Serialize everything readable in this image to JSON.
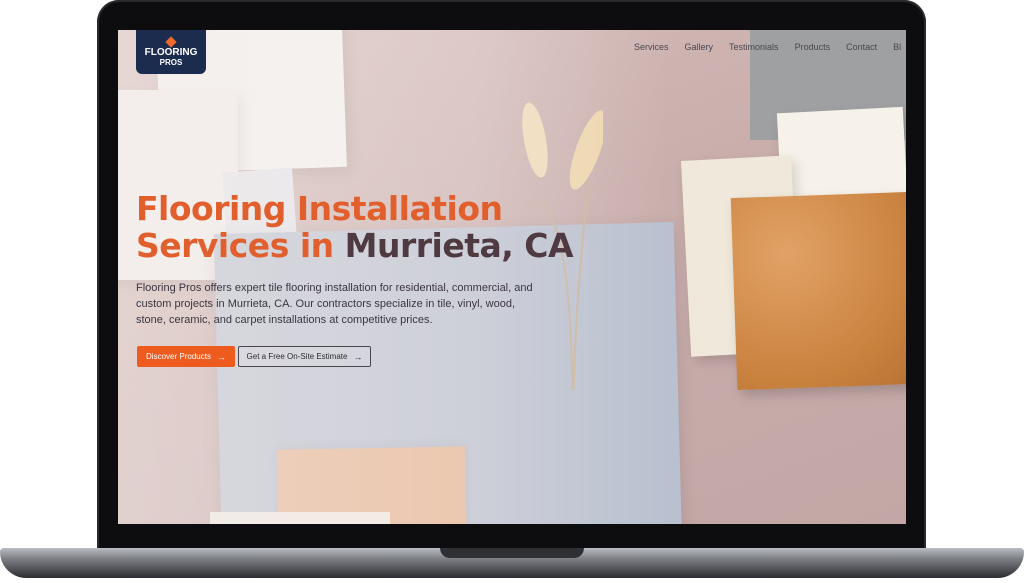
{
  "brand": {
    "logo_line1": "FLOORING",
    "logo_line2": "PROS",
    "accent": "#ee5b1e",
    "navy": "#1b2c4f"
  },
  "nav": {
    "items": [
      "Services",
      "Gallery",
      "Testimonials",
      "Products",
      "Contact",
      "Bl"
    ]
  },
  "hero": {
    "title_line1": "Flooring Installation",
    "title_line2_a": "Services in ",
    "title_line2_b": "Murrieta, CA",
    "description": "Flooring Pros offers expert tile flooring installation for residential, commercial, and custom projects in Murrieta, CA. Our contractors specialize in tile, vinyl, wood, stone, ceramic, and carpet installations at competitive prices.",
    "primary_button": "Discover Products",
    "secondary_button": "Get a Free On-Site Estimate",
    "arrow": "→"
  }
}
